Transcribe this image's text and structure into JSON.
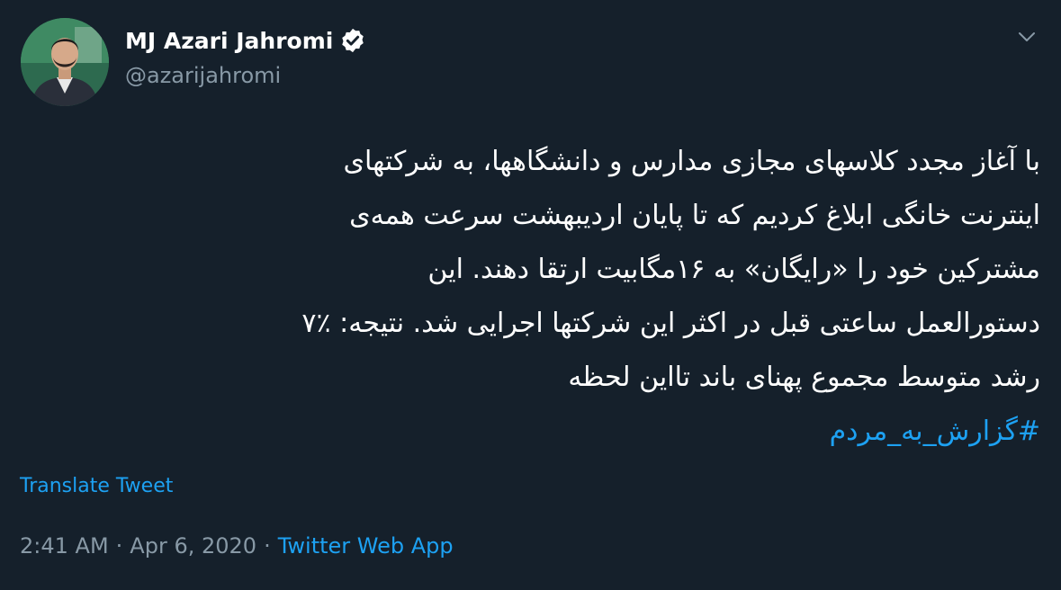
{
  "author": {
    "name": "MJ Azari Jahromi",
    "handle": "@azarijahromi",
    "verified": true
  },
  "tweet": {
    "lines": [
      "با آغاز مجدد کلاسهای مجازی مدارس و دانشگاهها، به شرکتهای",
      "اینترنت خانگی ابلاغ کردیم که تا پایان اردیبهشت سرعت همه‌ی",
      "مشترکین خود را «رایگان» به ۱۶مگابیت ارتقا دهند. این",
      "دستورالعمل ساعتی قبل در اکثر این شرکتها اجرایی شد. نتیجه: ٪۷",
      "رشد متوسط مجموع پهنای باند تااین لحظه"
    ],
    "hashtag": "#گزارش_به_مردم"
  },
  "translate_label": "Translate Tweet",
  "meta": {
    "time": "2:41 AM",
    "separator": "·",
    "date": "Apr 6, 2020",
    "source": "Twitter Web App"
  },
  "colors": {
    "background": "#15202b",
    "text": "#ffffff",
    "secondary": "#8899a6",
    "accent": "#1da1f2"
  },
  "icons": {
    "verified": "verified-badge-icon",
    "caret": "chevron-down-icon"
  }
}
